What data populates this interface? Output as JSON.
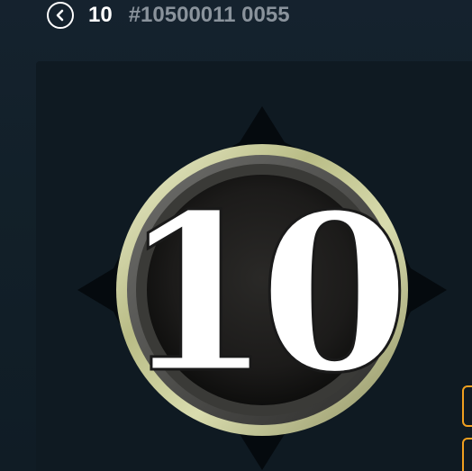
{
  "header": {
    "back_icon": "chevron-left-circle-icon",
    "title": "10",
    "code": "#10500011 0055"
  },
  "emblem": {
    "number": "10",
    "colors": {
      "ring": "#cfd3a6",
      "face": "#1c1c1c",
      "numeral": "#ffffff",
      "spikes": "#050a0e"
    }
  },
  "side_buttons": {
    "color": "#f0a020",
    "count": 2
  }
}
